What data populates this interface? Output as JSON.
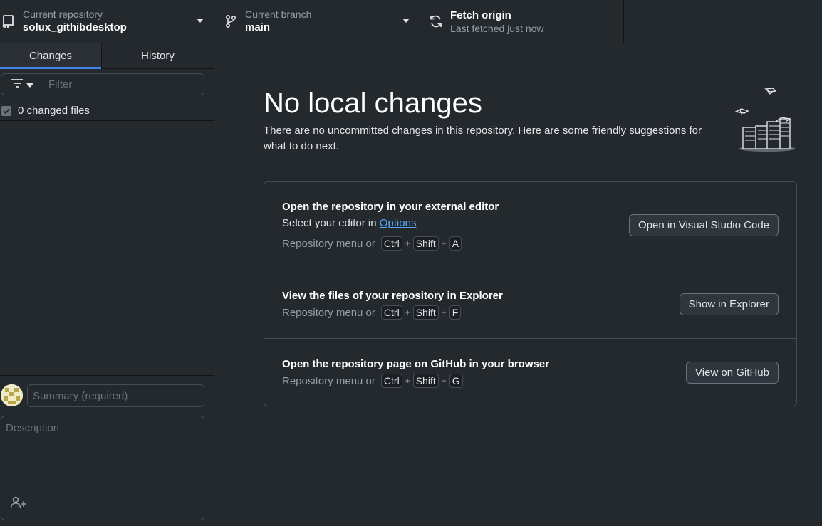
{
  "toolbar": {
    "repo": {
      "label": "Current repository",
      "value": "solux_githibdesktop",
      "icon": "repo-icon"
    },
    "branch": {
      "label": "Current branch",
      "value": "main",
      "icon": "branch-icon"
    },
    "fetch": {
      "title": "Fetch origin",
      "subtitle": "Last fetched just now",
      "icon": "sync-icon"
    }
  },
  "sidebar": {
    "tabs": [
      {
        "label": "Changes",
        "active": true
      },
      {
        "label": "History",
        "active": false
      }
    ],
    "filter": {
      "placeholder": "Filter"
    },
    "changed_files": {
      "label": "0 changed files",
      "checked": true
    },
    "commit": {
      "summary_placeholder": "Summary (required)",
      "description_placeholder": "Description"
    }
  },
  "main": {
    "title": "No local changes",
    "subtitle": "There are no uncommitted changes in this repository. Here are some friendly suggestions for what to do next.",
    "suggestions": [
      {
        "title": "Open the repository in your external editor",
        "desc_prefix": "Select your editor in ",
        "desc_link": "Options",
        "shortcut_prefix": "Repository menu or",
        "keys": [
          "Ctrl",
          "Shift",
          "A"
        ],
        "button": "Open in Visual Studio Code"
      },
      {
        "title": "View the files of your repository in Explorer",
        "shortcut_prefix": "Repository menu or",
        "keys": [
          "Ctrl",
          "Shift",
          "F"
        ],
        "button": "Show in Explorer"
      },
      {
        "title": "Open the repository page on GitHub in your browser",
        "shortcut_prefix": "Repository menu or",
        "keys": [
          "Ctrl",
          "Shift",
          "G"
        ],
        "button": "View on GitHub"
      }
    ],
    "key_separator": "+"
  },
  "colors": {
    "background": "#24292e",
    "border": "#141414",
    "accent": "#4184e4",
    "link": "#58a6ff"
  }
}
